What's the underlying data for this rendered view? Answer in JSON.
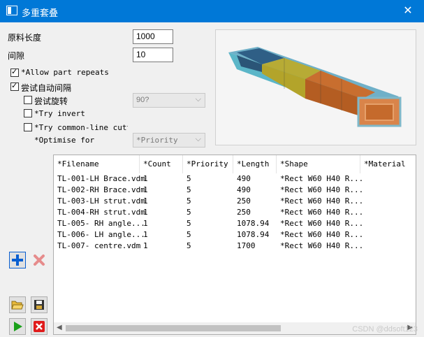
{
  "window": {
    "title": "多重套叠",
    "close_glyph": "✕"
  },
  "form": {
    "stock_length_label": "原料长度",
    "stock_length_value": "1000",
    "gap_label": "间隙",
    "gap_value": "10",
    "allow_repeats_label": "*Allow part repeats",
    "allow_repeats_checked": true,
    "auto_gap_label": "尝试自动间隔",
    "auto_gap_checked": true,
    "try_rotate_label": "尝试旋转",
    "try_rotate_checked": false,
    "rotate_value": "90?",
    "try_invert_label": "*Try invert",
    "try_invert_checked": false,
    "common_line_label": "*Try common-line cuttin",
    "common_line_checked": false,
    "optimise_label": "*Optimise for",
    "optimise_value": "*Priority"
  },
  "table": {
    "columns": [
      "*Filename",
      "*Count",
      "*Priority",
      "*Length",
      "*Shape",
      "*Material"
    ],
    "rows": [
      [
        "TL-001-LH Brace.vdm",
        "1",
        "5",
        "490",
        "*Rect W60 H40 R..."
      ],
      [
        "TL-002-RH Brace.vdm",
        "1",
        "5",
        "490",
        "*Rect W60 H40 R..."
      ],
      [
        "TL-003-LH strut.vdm",
        "1",
        "5",
        "250",
        "*Rect W60 H40 R..."
      ],
      [
        "TL-004-RH strut.vdm",
        "1",
        "5",
        "250",
        "*Rect W60 H40 R..."
      ],
      [
        "TL-005- RH angle...",
        "1",
        "5",
        "1078.94",
        "*Rect W60 H40 R..."
      ],
      [
        "TL-006- LH angle...",
        "1",
        "5",
        "1078.94",
        "*Rect W60 H40 R..."
      ],
      [
        "TL-007- centre.vdm",
        "1",
        "5",
        "1700",
        "*Rect W60 H40 R..."
      ]
    ]
  },
  "watermark": "CSDN @ddsoft123",
  "colors": {
    "titlebar": "#0078d7",
    "add": "#0a5fd1",
    "delete": "#d9534f",
    "run": "#1aa01a",
    "cancel": "#e01b1b"
  }
}
